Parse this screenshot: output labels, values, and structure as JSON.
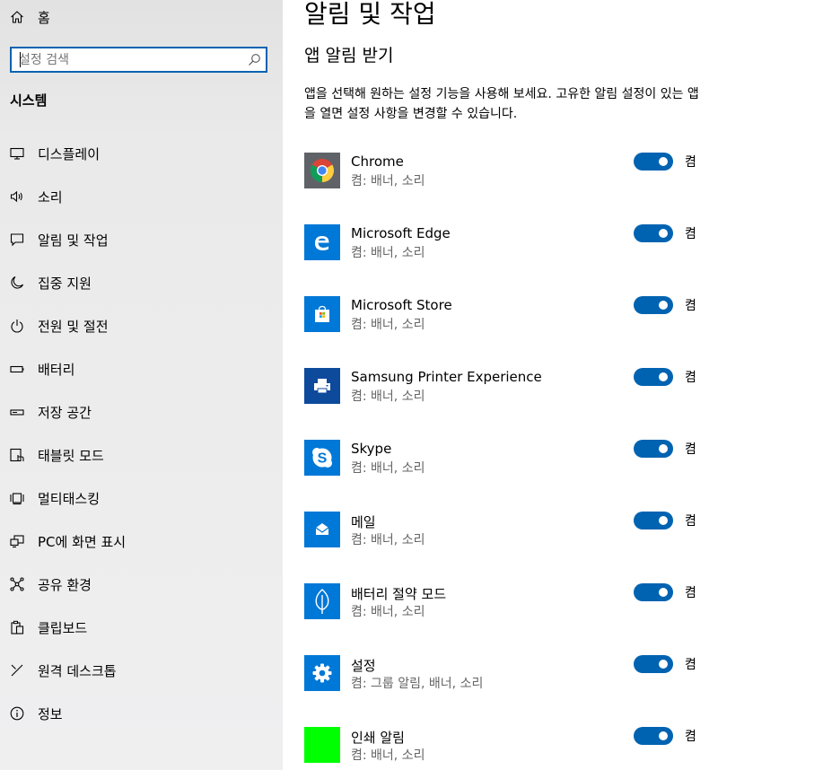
{
  "colors": {
    "accent": "#0063b1",
    "sidebar_bg": "#e6e6e6",
    "tile_blue": "#0078d7",
    "tile_dark_blue": "#004e8c",
    "tile_green": "#00ff00"
  },
  "sidebar": {
    "home": {
      "label": "홈",
      "icon": "home-icon"
    },
    "search": {
      "placeholder": "설정 검색",
      "icon": "search-icon"
    },
    "section_title": "시스템",
    "items": [
      {
        "label": "디스플레이",
        "icon": "display-icon"
      },
      {
        "label": "소리",
        "icon": "speaker-icon"
      },
      {
        "label": "알림 및 작업",
        "icon": "notification-icon"
      },
      {
        "label": "집중 지원",
        "icon": "moon-icon"
      },
      {
        "label": "전원 및 절전",
        "icon": "power-icon"
      },
      {
        "label": "배터리",
        "icon": "battery-icon"
      },
      {
        "label": "저장 공간",
        "icon": "storage-icon"
      },
      {
        "label": "태블릿 모드",
        "icon": "tablet-icon"
      },
      {
        "label": "멀티태스킹",
        "icon": "multitasking-icon"
      },
      {
        "label": "PC에 화면 표시",
        "icon": "project-icon"
      },
      {
        "label": "공유 환경",
        "icon": "share-icon"
      },
      {
        "label": "클립보드",
        "icon": "clipboard-icon"
      },
      {
        "label": "원격 데스크톱",
        "icon": "remote-desktop-icon"
      },
      {
        "label": "정보",
        "icon": "info-icon"
      }
    ]
  },
  "main": {
    "title": "알림 및 작업",
    "subtitle": "앱 알림 받기",
    "description": "앱을 선택해 원하는 설정 기능을 사용해 보세요. 고유한 알림 설정이 있는 앱을 열면 설정 사항을 변경할 수 있습니다.",
    "apps": [
      {
        "name": "Chrome",
        "sub": "켬: 배너, 소리",
        "toggle_label": "켬",
        "enabled": true,
        "icon": "chrome-icon"
      },
      {
        "name": "Microsoft Edge",
        "sub": "켬: 배너, 소리",
        "toggle_label": "켬",
        "enabled": true,
        "icon": "edge-icon"
      },
      {
        "name": "Microsoft Store",
        "sub": "켬: 배너, 소리",
        "toggle_label": "켬",
        "enabled": true,
        "icon": "store-icon"
      },
      {
        "name": "Samsung Printer Experience",
        "sub": "켬: 배너, 소리",
        "toggle_label": "켬",
        "enabled": true,
        "icon": "printer-icon"
      },
      {
        "name": "Skype",
        "sub": "켬: 배너, 소리",
        "toggle_label": "켬",
        "enabled": true,
        "icon": "skype-icon"
      },
      {
        "name": "메일",
        "sub": "켬: 배너, 소리",
        "toggle_label": "켬",
        "enabled": true,
        "icon": "mail-icon"
      },
      {
        "name": "배터리 절약 모드",
        "sub": "켬: 배너, 소리",
        "toggle_label": "켬",
        "enabled": true,
        "icon": "leaf-icon"
      },
      {
        "name": "설정",
        "sub": "켬: 그룹 알림, 배너, 소리",
        "toggle_label": "켬",
        "enabled": true,
        "icon": "gear-icon"
      },
      {
        "name": "인쇄 알림",
        "sub": "켬: 배너, 소리",
        "toggle_label": "켬",
        "enabled": true,
        "icon": "print-notification-icon"
      }
    ]
  }
}
